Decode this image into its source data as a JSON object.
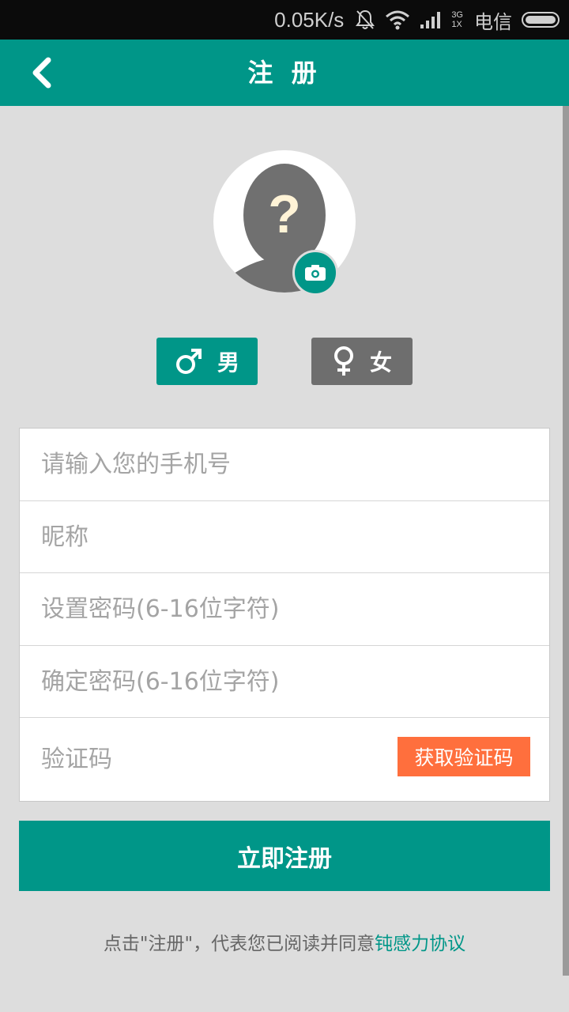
{
  "status_bar": {
    "speed": "0.05K/s",
    "network_top": "3G",
    "network_bottom": "1X",
    "carrier": "电信",
    "icons": [
      "bell-off-icon",
      "wifi-icon",
      "signal-icon",
      "battery-icon"
    ]
  },
  "header": {
    "title": "注 册",
    "back_icon": "chevron-left-icon"
  },
  "avatar": {
    "question_mark": "?",
    "camera_icon": "camera-icon"
  },
  "gender": {
    "male_label": "男",
    "female_label": "女",
    "selected": "male"
  },
  "form": {
    "phone_placeholder": "请输入您的手机号",
    "nickname_placeholder": "昵称",
    "password_placeholder": "设置密码(6-16位字符)",
    "confirm_password_placeholder": "确定密码(6-16位字符)",
    "verification_placeholder": "验证码",
    "get_code_label": "获取验证码"
  },
  "register_button": "立即注册",
  "agreement": {
    "prefix": "点击\"注册\"，代表您已阅读并同意",
    "link": "钝感力协议"
  },
  "colors": {
    "primary": "#009688",
    "accent": "#ff6f3d",
    "background": "#dddddd",
    "inactive": "#6e6e6e"
  }
}
